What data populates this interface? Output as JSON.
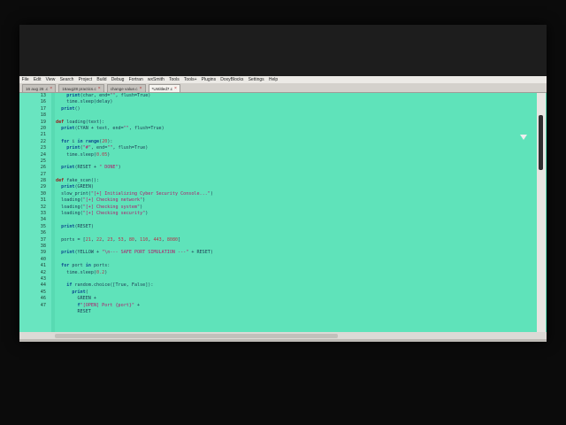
{
  "menu": [
    "File",
    "Edit",
    "View",
    "Search",
    "Project",
    "Build",
    "Debug",
    "Fortran",
    "wxSmith",
    "Tools",
    "Tools+",
    "Plugins",
    "DoxyBlocks",
    "Settings",
    "Help"
  ],
  "tabs": [
    {
      "label": "16 aug 26 .c",
      "active": false
    },
    {
      "label": "16aug28 practics.c",
      "active": false
    },
    {
      "label": "change value.c",
      "active": false
    },
    {
      "label": "*Untitled7.c",
      "active": true
    }
  ],
  "tab_close_glyph": "×",
  "editor": {
    "background": "#5fe3ba",
    "line_numbers": [
      "13",
      "16",
      "17",
      "18",
      "19",
      "20",
      "21",
      "22",
      "23",
      "24",
      "25",
      "26",
      "27",
      "28",
      "29",
      "30",
      "31",
      "32",
      "33",
      "34",
      "35",
      "36",
      "37",
      "38",
      "39",
      "40",
      "41",
      "42",
      "43",
      "44",
      "45",
      "46",
      "47"
    ],
    "lines": [
      "    print(char, end=\"\", flush=True)",
      "    time.sleep(delay)",
      "  print()",
      "",
      "def loading(text):",
      "  print(CYAN + text, end=\"\", flush=True)",
      "",
      "  for i in range(20):",
      "    print(\"#\", end=\"\", flush=True)",
      "    time.sleep(0.05)",
      "",
      "  print(RESET + \" DONE\")",
      "",
      "def fake_scan():",
      "  print(GREEN)",
      "  slow_print(\"[+] Initializing Cyber Security Console...\")",
      "  loading(\"[+] Checking network\")",
      "  loading(\"[+] Checking system\")",
      "  loading(\"[+] Checking security\")",
      "",
      "  print(RESET)",
      "",
      "  ports = [21, 22, 23, 53, 80, 110, 443, 8080]",
      "",
      "  print(YELLOW + \"\\n--- SAFE PORT SIMULATION ---\" + RESET)",
      "",
      "  for port in ports:",
      "    time.sleep(0.2)",
      "",
      "    if random.choice([True, False]):",
      "      print(",
      "        GREEN +",
      "        f\"[OPEN] Port {port}\" +",
      "        RESET"
    ]
  },
  "icons": {
    "scroll_thumb": "vertical-scroll-thumb",
    "mouse_cursor": "mouse-cursor-icon"
  }
}
